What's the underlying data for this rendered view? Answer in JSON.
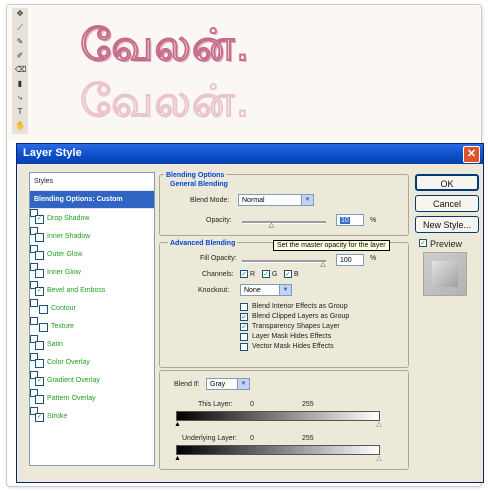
{
  "canvas": {
    "art_lines": [
      "வேலன்.",
      "வேலன்."
    ]
  },
  "dialog": {
    "title": "Layer Style",
    "close_glyph": "✕"
  },
  "styles_panel": {
    "items": [
      {
        "label": "Styles",
        "checkbox": false,
        "checked": false,
        "selected": false,
        "indent": false
      },
      {
        "label": "Blending Options: Custom",
        "checkbox": false,
        "checked": false,
        "selected": true,
        "indent": false
      },
      {
        "label": "Drop Shadow",
        "checkbox": true,
        "checked": true,
        "selected": false,
        "indent": false
      },
      {
        "label": "Inner Shadow",
        "checkbox": true,
        "checked": false,
        "selected": false,
        "indent": false
      },
      {
        "label": "Outer Glow",
        "checkbox": true,
        "checked": false,
        "selected": false,
        "indent": false
      },
      {
        "label": "Inner Glow",
        "checkbox": true,
        "checked": false,
        "selected": false,
        "indent": false
      },
      {
        "label": "Bevel and Emboss",
        "checkbox": true,
        "checked": true,
        "selected": false,
        "indent": false
      },
      {
        "label": "Contour",
        "checkbox": true,
        "checked": false,
        "selected": false,
        "indent": true
      },
      {
        "label": "Texture",
        "checkbox": true,
        "checked": false,
        "selected": false,
        "indent": true
      },
      {
        "label": "Satin",
        "checkbox": true,
        "checked": false,
        "selected": false,
        "indent": false
      },
      {
        "label": "Color Overlay",
        "checkbox": true,
        "checked": false,
        "selected": false,
        "indent": false
      },
      {
        "label": "Gradient Overlay",
        "checkbox": true,
        "checked": true,
        "selected": false,
        "indent": false
      },
      {
        "label": "Pattern Overlay",
        "checkbox": true,
        "checked": false,
        "selected": false,
        "indent": false
      },
      {
        "label": "Stroke",
        "checkbox": true,
        "checked": true,
        "selected": false,
        "indent": false
      }
    ]
  },
  "blending": {
    "section_title": "Blending Options",
    "general_title": "General Blending",
    "blend_mode_label": "Blend Mode:",
    "blend_mode_value": "Normal",
    "opacity_label": "Opacity:",
    "opacity_value": "10",
    "opacity_unit": "%",
    "opacity_level": 0.35,
    "advanced_title": "Advanced Blending",
    "fill_opacity_label": "Fill Opacity:",
    "fill_opacity_value": "100",
    "fill_opacity_unit": "%",
    "channels_label": "Channels:",
    "channels": [
      {
        "name": "R",
        "checked": true
      },
      {
        "name": "G",
        "checked": true
      },
      {
        "name": "B",
        "checked": true
      }
    ],
    "knockout_label": "Knockout:",
    "knockout_value": "None",
    "options": [
      {
        "label": "Blend Interior Effects as Group",
        "checked": false
      },
      {
        "label": "Blend Clipped Layers as Group",
        "checked": true
      },
      {
        "label": "Transparency Shapes Layer",
        "checked": true
      },
      {
        "label": "Layer Mask Hides Effects",
        "checked": false
      },
      {
        "label": "Vector Mask Hides Effects",
        "checked": false
      }
    ],
    "tooltip": "Set the master opacity for the layer",
    "blend_if_label": "Blend If:",
    "blend_if_value": "Gray",
    "this_layer_label": "This Layer:",
    "this_layer_min": "0",
    "this_layer_max": "255",
    "underlying_label": "Underlying Layer:",
    "underlying_min": "0",
    "underlying_max": "255"
  },
  "buttons": {
    "ok": "OK",
    "cancel": "Cancel",
    "new_style": "New Style...",
    "preview_label": "Preview",
    "preview_checked": true
  },
  "colors": {
    "title_bar": "#0b4cc7",
    "selection": "#3165c4",
    "dialog_bg": "#ece9d8",
    "art_stroke": "#c66b8a"
  }
}
